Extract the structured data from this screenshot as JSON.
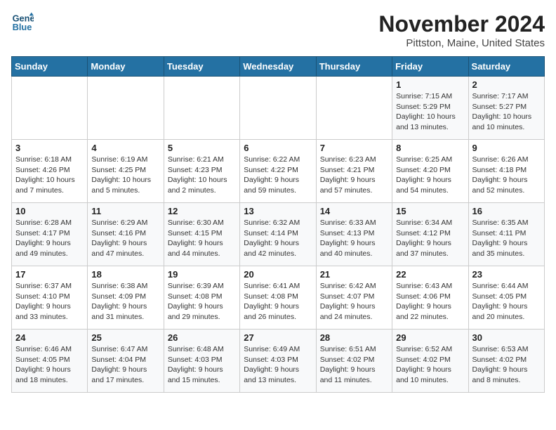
{
  "header": {
    "logo_line1": "General",
    "logo_line2": "Blue",
    "month": "November 2024",
    "location": "Pittston, Maine, United States"
  },
  "days_of_week": [
    "Sunday",
    "Monday",
    "Tuesday",
    "Wednesday",
    "Thursday",
    "Friday",
    "Saturday"
  ],
  "weeks": [
    [
      {
        "day": "",
        "info": ""
      },
      {
        "day": "",
        "info": ""
      },
      {
        "day": "",
        "info": ""
      },
      {
        "day": "",
        "info": ""
      },
      {
        "day": "",
        "info": ""
      },
      {
        "day": "1",
        "info": "Sunrise: 7:15 AM\nSunset: 5:29 PM\nDaylight: 10 hours and 13 minutes."
      },
      {
        "day": "2",
        "info": "Sunrise: 7:17 AM\nSunset: 5:27 PM\nDaylight: 10 hours and 10 minutes."
      }
    ],
    [
      {
        "day": "3",
        "info": "Sunrise: 6:18 AM\nSunset: 4:26 PM\nDaylight: 10 hours and 7 minutes."
      },
      {
        "day": "4",
        "info": "Sunrise: 6:19 AM\nSunset: 4:25 PM\nDaylight: 10 hours and 5 minutes."
      },
      {
        "day": "5",
        "info": "Sunrise: 6:21 AM\nSunset: 4:23 PM\nDaylight: 10 hours and 2 minutes."
      },
      {
        "day": "6",
        "info": "Sunrise: 6:22 AM\nSunset: 4:22 PM\nDaylight: 9 hours and 59 minutes."
      },
      {
        "day": "7",
        "info": "Sunrise: 6:23 AM\nSunset: 4:21 PM\nDaylight: 9 hours and 57 minutes."
      },
      {
        "day": "8",
        "info": "Sunrise: 6:25 AM\nSunset: 4:20 PM\nDaylight: 9 hours and 54 minutes."
      },
      {
        "day": "9",
        "info": "Sunrise: 6:26 AM\nSunset: 4:18 PM\nDaylight: 9 hours and 52 minutes."
      }
    ],
    [
      {
        "day": "10",
        "info": "Sunrise: 6:28 AM\nSunset: 4:17 PM\nDaylight: 9 hours and 49 minutes."
      },
      {
        "day": "11",
        "info": "Sunrise: 6:29 AM\nSunset: 4:16 PM\nDaylight: 9 hours and 47 minutes."
      },
      {
        "day": "12",
        "info": "Sunrise: 6:30 AM\nSunset: 4:15 PM\nDaylight: 9 hours and 44 minutes."
      },
      {
        "day": "13",
        "info": "Sunrise: 6:32 AM\nSunset: 4:14 PM\nDaylight: 9 hours and 42 minutes."
      },
      {
        "day": "14",
        "info": "Sunrise: 6:33 AM\nSunset: 4:13 PM\nDaylight: 9 hours and 40 minutes."
      },
      {
        "day": "15",
        "info": "Sunrise: 6:34 AM\nSunset: 4:12 PM\nDaylight: 9 hours and 37 minutes."
      },
      {
        "day": "16",
        "info": "Sunrise: 6:35 AM\nSunset: 4:11 PM\nDaylight: 9 hours and 35 minutes."
      }
    ],
    [
      {
        "day": "17",
        "info": "Sunrise: 6:37 AM\nSunset: 4:10 PM\nDaylight: 9 hours and 33 minutes."
      },
      {
        "day": "18",
        "info": "Sunrise: 6:38 AM\nSunset: 4:09 PM\nDaylight: 9 hours and 31 minutes."
      },
      {
        "day": "19",
        "info": "Sunrise: 6:39 AM\nSunset: 4:08 PM\nDaylight: 9 hours and 29 minutes."
      },
      {
        "day": "20",
        "info": "Sunrise: 6:41 AM\nSunset: 4:08 PM\nDaylight: 9 hours and 26 minutes."
      },
      {
        "day": "21",
        "info": "Sunrise: 6:42 AM\nSunset: 4:07 PM\nDaylight: 9 hours and 24 minutes."
      },
      {
        "day": "22",
        "info": "Sunrise: 6:43 AM\nSunset: 4:06 PM\nDaylight: 9 hours and 22 minutes."
      },
      {
        "day": "23",
        "info": "Sunrise: 6:44 AM\nSunset: 4:05 PM\nDaylight: 9 hours and 20 minutes."
      }
    ],
    [
      {
        "day": "24",
        "info": "Sunrise: 6:46 AM\nSunset: 4:05 PM\nDaylight: 9 hours and 18 minutes."
      },
      {
        "day": "25",
        "info": "Sunrise: 6:47 AM\nSunset: 4:04 PM\nDaylight: 9 hours and 17 minutes."
      },
      {
        "day": "26",
        "info": "Sunrise: 6:48 AM\nSunset: 4:03 PM\nDaylight: 9 hours and 15 minutes."
      },
      {
        "day": "27",
        "info": "Sunrise: 6:49 AM\nSunset: 4:03 PM\nDaylight: 9 hours and 13 minutes."
      },
      {
        "day": "28",
        "info": "Sunrise: 6:51 AM\nSunset: 4:02 PM\nDaylight: 9 hours and 11 minutes."
      },
      {
        "day": "29",
        "info": "Sunrise: 6:52 AM\nSunset: 4:02 PM\nDaylight: 9 hours and 10 minutes."
      },
      {
        "day": "30",
        "info": "Sunrise: 6:53 AM\nSunset: 4:02 PM\nDaylight: 9 hours and 8 minutes."
      }
    ]
  ]
}
